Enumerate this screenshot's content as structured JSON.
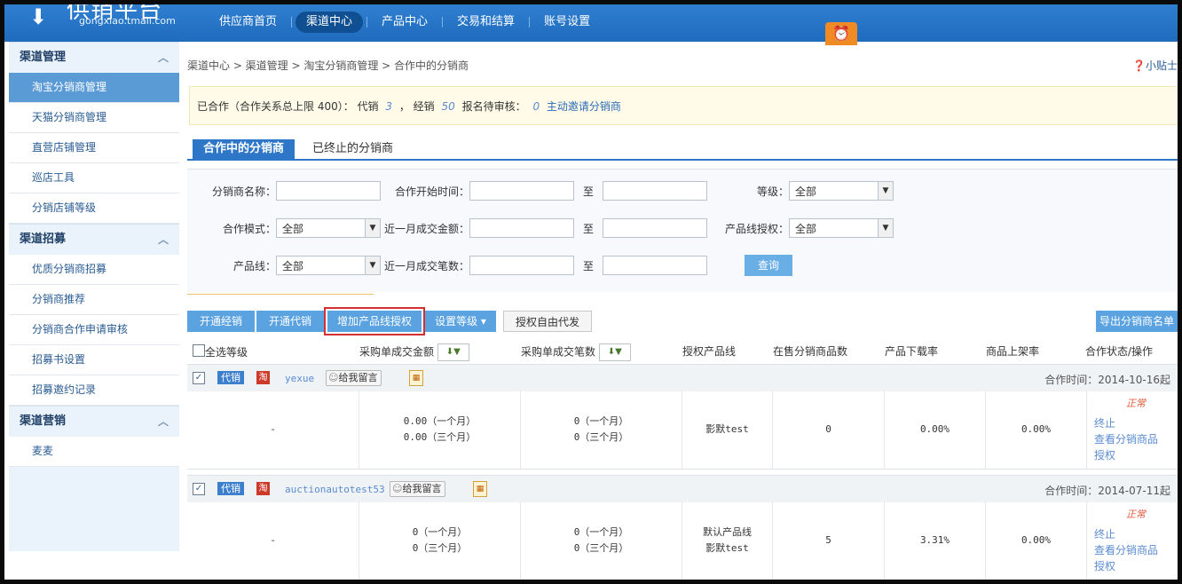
{
  "logo": {
    "text": "供销平台",
    "domain": "gongxiao.tmall.com"
  },
  "nav": [
    "供应商首页",
    "渠道中心",
    "产品中心",
    "交易和结算",
    "账号设置"
  ],
  "nav_active": 1,
  "sidebar": {
    "sections": [
      {
        "title": "渠道管理",
        "items": [
          "淘宝分销商管理",
          "天猫分销商管理",
          "直营店铺管理",
          "巡店工具",
          "分销店铺等级"
        ]
      },
      {
        "title": "渠道招募",
        "items": [
          "优质分销商招募",
          "分销商推荐",
          "分销商合作申请审核",
          "招募书设置",
          "招募邀约记录"
        ]
      },
      {
        "title": "渠道营销",
        "items": [
          "麦麦"
        ]
      }
    ]
  },
  "breadcrumb": "渠道中心 > 渠道管理 > 淘宝分销商管理 > 合作中的分销商",
  "tip": "小贴士",
  "summary": {
    "prefix": "已合作（合作关系总上限 400）： 代销",
    "consign": "3",
    "mid": "， 经销",
    "distrib": "50",
    "pending_label": "报名待审核：",
    "pending": "0",
    "invite": "主动邀请分销商"
  },
  "tabs": [
    "合作中的分销商",
    "已终止的分销商"
  ],
  "filter": {
    "name_label": "分销商名称：",
    "start_label": "合作开始时间：",
    "to": "至",
    "level_label": "等级：",
    "level_value": "全部",
    "mode_label": "合作模式：",
    "mode_value": "全部",
    "amount_label": "近一月成交金额：",
    "auth_label": "产品线授权：",
    "auth_value": "全部",
    "line_label": "产品线：",
    "line_value": "全部",
    "count_label": "近一月成交笔数：",
    "query": "查询"
  },
  "toolbar": {
    "open_dist": "开通经销",
    "open_consign": "开通代销",
    "add_auth": "增加产品线授权",
    "set_level": "设置等级",
    "auth_free": "授权自由代发",
    "export": "导出分销商名单"
  },
  "table": {
    "headers": [
      "全选等级",
      "采购单成交金额",
      "采购单成交笔数",
      "授权产品线",
      "在售分销商品数",
      "产品下载率",
      "商品上架率",
      "合作状态/操作"
    ],
    "rows": [
      {
        "type": "代销",
        "platform": "淘",
        "name": "yexue",
        "msg": "给我留言",
        "coop_time": "合作时间：2014-10-16起",
        "level": "-",
        "amount": [
          "0.00（一个月）",
          "0.00（三个月）"
        ],
        "count": [
          "0（一个月）",
          "0（三个月）"
        ],
        "lines": [
          "影默test"
        ],
        "on_sale": "0",
        "download": "0.00%",
        "shelf": "0.00%",
        "status": "正常",
        "actions": [
          "终止",
          "查看分销商品",
          "授权"
        ]
      },
      {
        "type": "代销",
        "platform": "淘",
        "name": "auctionautotest53",
        "msg": "给我留言",
        "coop_time": "合作时间：2014-07-11起",
        "level": "-",
        "amount": [
          "0（一个月）",
          "0（三个月）"
        ],
        "count": [
          "0（一个月）",
          "0（三个月）"
        ],
        "lines": [
          "默认产品线",
          "影默test"
        ],
        "on_sale": "5",
        "download": "3.31%",
        "shelf": "0.00%",
        "status": "正常",
        "actions": [
          "终止",
          "查看分销商品",
          "授权"
        ]
      }
    ]
  }
}
